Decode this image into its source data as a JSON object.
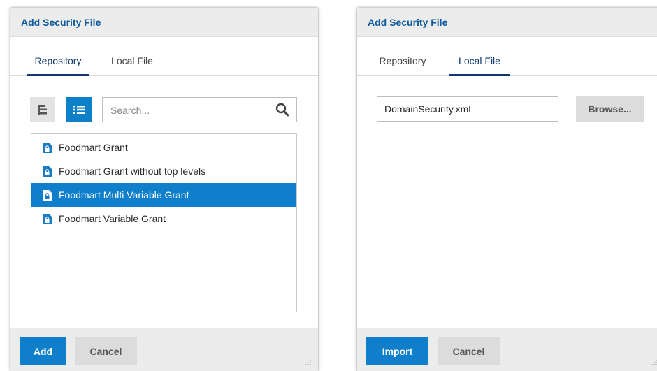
{
  "dialog_left": {
    "title": "Add Security File",
    "tabs": [
      {
        "label": "Repository",
        "active": true
      },
      {
        "label": "Local File",
        "active": false
      }
    ],
    "toolbar": {
      "tree_view_icon": "tree-view-icon",
      "list_view_icon": "list-view-icon"
    },
    "search": {
      "placeholder": "Search..."
    },
    "files": [
      {
        "label": "Foodmart Grant",
        "selected": false
      },
      {
        "label": "Foodmart Grant without top levels",
        "selected": false
      },
      {
        "label": "Foodmart Multi Variable Grant",
        "selected": true
      },
      {
        "label": "Foodmart Variable Grant",
        "selected": false
      }
    ],
    "buttons": {
      "primary": "Add",
      "secondary": "Cancel"
    }
  },
  "dialog_right": {
    "title": "Add Security File",
    "tabs": [
      {
        "label": "Repository",
        "active": false
      },
      {
        "label": "Local File",
        "active": true
      }
    ],
    "file_field": {
      "value": "DomainSecurity.xml"
    },
    "browse_label": "Browse...",
    "buttons": {
      "primary": "Import",
      "secondary": "Cancel"
    }
  },
  "colors": {
    "accent": "#0f7fcb",
    "title": "#0e5a9c",
    "tab_active": "#0f3a6e",
    "header_bg": "#ececec",
    "secondary_button": "#dcdcdc"
  }
}
